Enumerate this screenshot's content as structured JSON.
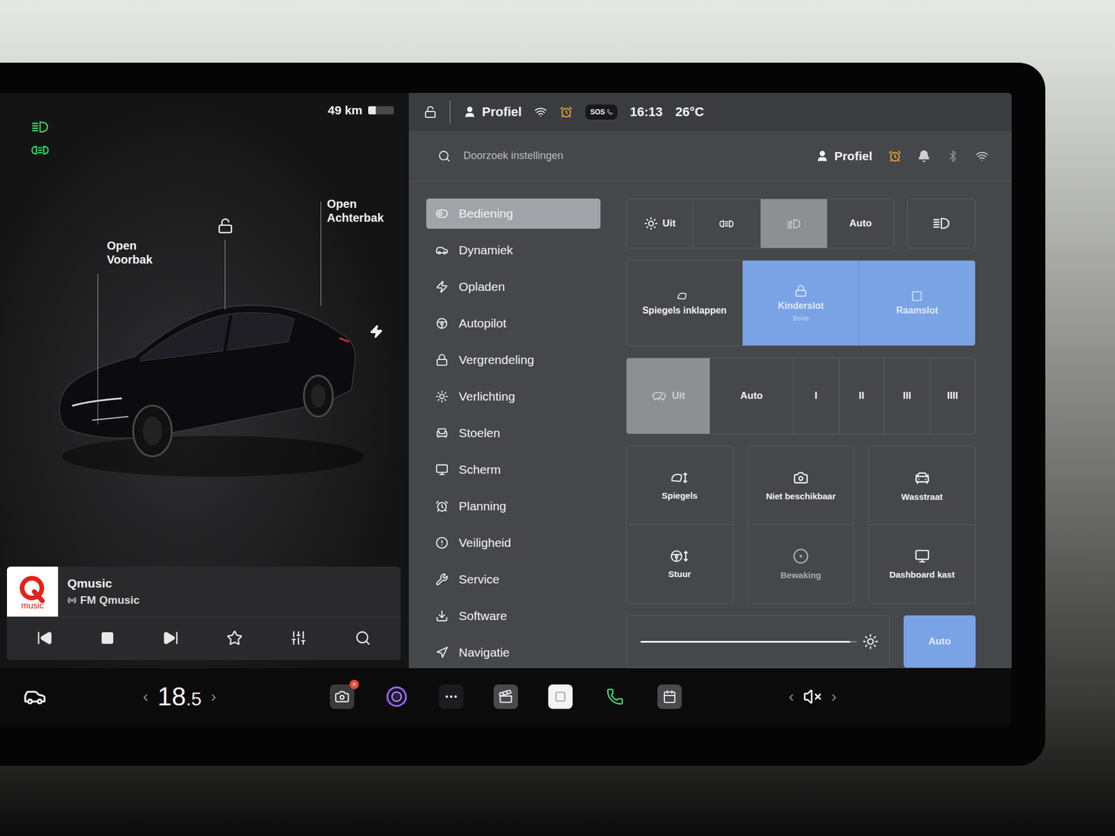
{
  "leftPanel": {
    "range": "49 km",
    "batteryLevel": 0.3,
    "indicators": [
      {
        "kind": "highbeam",
        "on": true
      },
      {
        "kind": "parking",
        "on": true
      }
    ],
    "car": {
      "frunkLabel": "Open Voorbak",
      "trunkLabel": "Open Achterbak",
      "locked": false,
      "charging": true
    }
  },
  "media": {
    "logo": "music",
    "station": "Qmusic",
    "source": "FM Qmusic",
    "favorite": false
  },
  "statusBar": {
    "profile": "Profiel",
    "sos": "SOS",
    "time": "16:13",
    "temperature": "26°C"
  },
  "search": {
    "placeholder": "Doorzoek instellingen",
    "profile": "Profiel"
  },
  "menu": [
    {
      "label": "Bediening",
      "selected": true
    },
    {
      "label": "Dynamiek",
      "selected": false
    },
    {
      "label": "Opladen",
      "selected": false
    },
    {
      "label": "Autopilot",
      "selected": false
    },
    {
      "label": "Vergrendeling",
      "selected": false
    },
    {
      "label": "Verlichting",
      "selected": false
    },
    {
      "label": "Stoelen",
      "selected": false
    },
    {
      "label": "Scherm",
      "selected": false
    },
    {
      "label": "Planning",
      "selected": false
    },
    {
      "label": "Veiligheid",
      "selected": false
    },
    {
      "label": "Service",
      "selected": false
    },
    {
      "label": "Software",
      "selected": false
    },
    {
      "label": "Navigatie",
      "selected": false
    }
  ],
  "lights": [
    {
      "kind": "sun-text",
      "label": "Uit",
      "selected": false
    },
    {
      "kind": "parking",
      "selected": false
    },
    {
      "kind": "lowbeam",
      "selected": true
    },
    {
      "kind": "text",
      "label": "Auto",
      "selected": false
    }
  ],
  "highBeam": {
    "on": false
  },
  "tiles": [
    {
      "label": "Spiegels inklappen",
      "on": false
    },
    {
      "label": "Kinderslot",
      "sublabel": "Beide",
      "on": true
    },
    {
      "label": "Raamslot",
      "on": true
    }
  ],
  "wipers": [
    {
      "kind": "icon-text",
      "label": "Uit",
      "selected": true
    },
    {
      "kind": "text",
      "label": "Auto",
      "selected": false
    },
    {
      "kind": "text",
      "label": "I",
      "selected": false
    },
    {
      "kind": "text",
      "label": "II",
      "selected": false
    },
    {
      "kind": "text",
      "label": "III",
      "selected": false
    },
    {
      "kind": "text",
      "label": "IIII",
      "selected": false
    }
  ],
  "controls": [
    {
      "label": "Spiegels",
      "disabled": false
    },
    {
      "label": "Niet beschikbaar",
      "disabled": false
    },
    {
      "label": "Wasstraat",
      "disabled": false
    },
    {
      "label": "Stuur",
      "disabled": false
    },
    {
      "label": "Bewaking",
      "disabled": true
    },
    {
      "label": "Dashboard kast",
      "disabled": false
    }
  ],
  "brightness": {
    "level": 0.97,
    "auto": true,
    "autoLabel": "Auto"
  },
  "dock": {
    "temperature": {
      "whole": "18",
      "fraction": ".5",
      "decrease": "‹",
      "increase": "›"
    },
    "apps": [
      {
        "kind": "camera",
        "badge": "×"
      },
      {
        "kind": "dashcam"
      },
      {
        "kind": "more"
      },
      {
        "kind": "video"
      },
      {
        "kind": "notes"
      },
      {
        "kind": "phone"
      },
      {
        "kind": "calendar"
      }
    ],
    "volume": {
      "muted": true,
      "decrease": "‹",
      "increase": "›"
    }
  }
}
